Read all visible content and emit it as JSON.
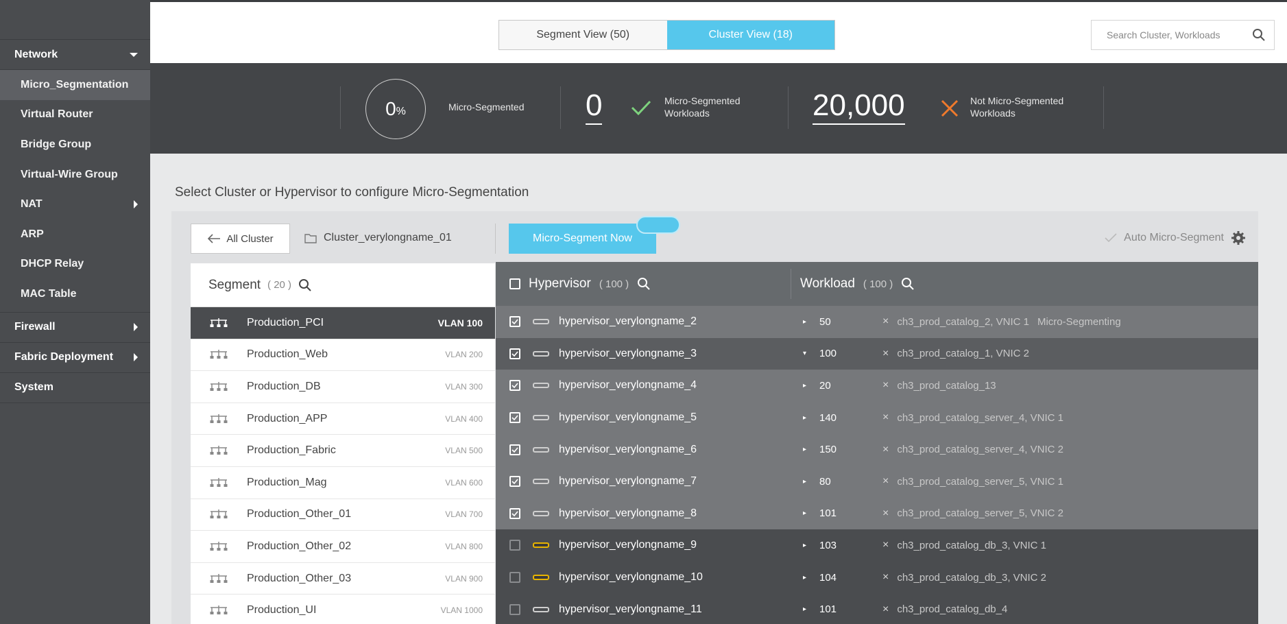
{
  "sidebar": {
    "sections": [
      {
        "label": "Network",
        "arrow": "down"
      },
      {
        "label": "Firewall",
        "arrow": "right"
      },
      {
        "label": "Fabric Deployment",
        "arrow": "right"
      },
      {
        "label": "System",
        "arrow": ""
      }
    ],
    "network_items": [
      {
        "label": "Micro_Segmentation",
        "active": true
      },
      {
        "label": "Virtual Router"
      },
      {
        "label": "Bridge Group"
      },
      {
        "label": "Virtual-Wire Group"
      },
      {
        "label": "NAT",
        "arrow": "right"
      },
      {
        "label": "ARP"
      },
      {
        "label": "DHCP Relay"
      },
      {
        "label": "MAC Table"
      }
    ]
  },
  "header": {
    "segment_view": "Segment View (50)",
    "cluster_view": "Cluster View (18)",
    "search_placeholder": "Search Cluster, Workloads"
  },
  "stats": {
    "percent_value": "0",
    "percent_unit": "%",
    "percent_label": "Micro-Segmented",
    "segmented_count": "0",
    "segmented_label_1": "Micro-Segmented",
    "segmented_label_2": "Workloads",
    "not_segmented_count": "20,000",
    "not_segmented_label_1": "Not Micro-Segmented",
    "not_segmented_label_2": "Workloads",
    "colors": {
      "check": "#7ed37e",
      "cross": "#f07a2c"
    }
  },
  "main": {
    "instruction": "Select Cluster or Hypervisor to configure Micro-Segmentation",
    "back_button": "All Cluster",
    "cluster_name": "Cluster_verylongname_01",
    "micro_segment_button": "Micro-Segment Now",
    "auto_micro_segment": "Auto Micro-Segment",
    "accent_color": "#56c7ec"
  },
  "segments": {
    "header": "Segment",
    "count": "( 20 )",
    "rows": [
      {
        "name": "Production_PCI",
        "vlan": "VLAN 100"
      },
      {
        "name": "Production_Web",
        "vlan": "VLAN 200"
      },
      {
        "name": "Production_DB",
        "vlan": "VLAN 300"
      },
      {
        "name": "Production_APP",
        "vlan": "VLAN 400"
      },
      {
        "name": "Production_Fabric",
        "vlan": "VLAN 500"
      },
      {
        "name": "Production_Mag",
        "vlan": "VLAN 600"
      },
      {
        "name": "Production_Other_01",
        "vlan": "VLAN 700"
      },
      {
        "name": "Production_Other_02",
        "vlan": "VLAN 800"
      },
      {
        "name": "Production_Other_03",
        "vlan": "VLAN 900"
      },
      {
        "name": "Production_UI",
        "vlan": "VLAN 1000"
      }
    ]
  },
  "hypervisors": {
    "header": "Hypervisor",
    "count": "( 100 )",
    "workload_header": "Workload",
    "workload_count": "( 100 )",
    "rows": [
      {
        "name": "hypervisor_verylongname_2",
        "workloads": "50",
        "checked": true,
        "warn": false,
        "caret": "▸",
        "workload_item": "ch3_prod_catalog_2, VNIC 1",
        "status": "Micro-Segmenting",
        "shade": "light"
      },
      {
        "name": "hypervisor_verylongname_3",
        "workloads": "100",
        "checked": true,
        "warn": false,
        "caret": "▾",
        "workload_item": "ch3_prod_catalog_1, VNIC 2",
        "status": "",
        "shade": "dark"
      },
      {
        "name": "hypervisor_verylongname_4",
        "workloads": "20",
        "checked": true,
        "warn": false,
        "caret": "▸",
        "workload_item": "ch3_prod_catalog_13",
        "status": "",
        "shade": "light"
      },
      {
        "name": "hypervisor_verylongname_5",
        "workloads": "140",
        "checked": true,
        "warn": false,
        "caret": "▸",
        "workload_item": "ch3_prod_catalog_server_4, VNIC 1",
        "status": "",
        "shade": "light"
      },
      {
        "name": "hypervisor_verylongname_6",
        "workloads": "150",
        "checked": true,
        "warn": false,
        "caret": "▸",
        "workload_item": "ch3_prod_catalog_server_4, VNIC 2",
        "status": "",
        "shade": "light"
      },
      {
        "name": "hypervisor_verylongname_7",
        "workloads": "80",
        "checked": true,
        "warn": false,
        "caret": "▸",
        "workload_item": "ch3_prod_catalog_server_5, VNIC 1",
        "status": "",
        "shade": "light"
      },
      {
        "name": "hypervisor_verylongname_8",
        "workloads": "101",
        "checked": true,
        "warn": false,
        "caret": "▸",
        "workload_item": "ch3_prod_catalog_server_5, VNIC 2",
        "status": "",
        "shade": "light"
      },
      {
        "name": "hypervisor_verylongname_9",
        "workloads": "103",
        "checked": false,
        "warn": true,
        "caret": "▸",
        "workload_item": "ch3_prod_catalog_db_3, VNIC 1",
        "status": "",
        "shade": "darker"
      },
      {
        "name": "hypervisor_verylongname_10",
        "workloads": "104",
        "checked": false,
        "warn": true,
        "caret": "▸",
        "workload_item": "ch3_prod_catalog_db_3, VNIC 2",
        "status": "",
        "shade": "darker"
      },
      {
        "name": "hypervisor_verylongname_11",
        "workloads": "101",
        "checked": false,
        "warn": false,
        "caret": "▸",
        "workload_item": "ch3_prod_catalog_db_4",
        "status": "",
        "shade": "darker"
      }
    ]
  }
}
